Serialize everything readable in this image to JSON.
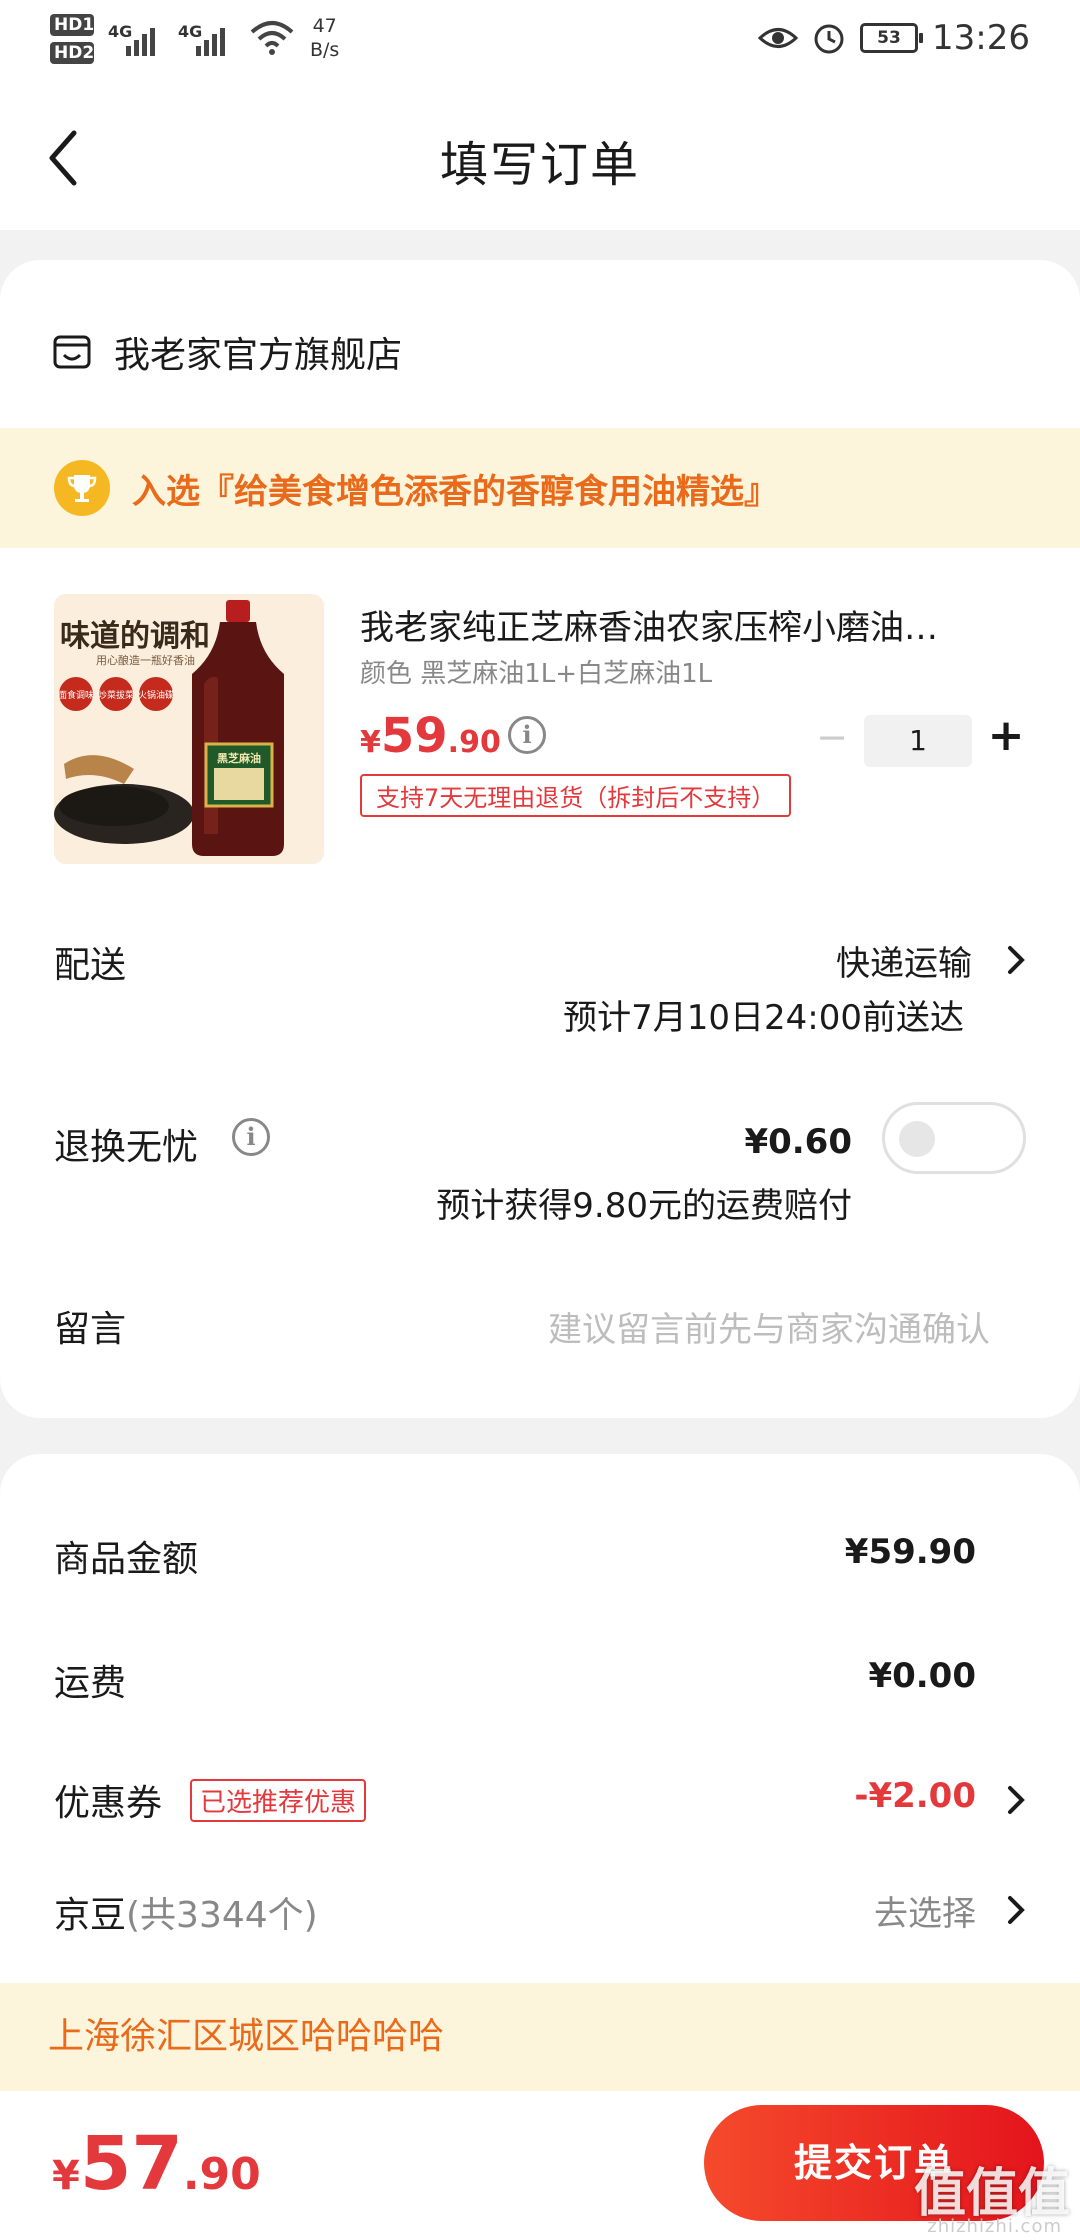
{
  "status_bar": {
    "sim1": "HD",
    "sim2": "HD",
    "sim1_sub": "1",
    "sim2_sub": "2",
    "net1": "4G",
    "net2": "4G",
    "speed_value": "47",
    "speed_unit": "B/s",
    "battery": "53",
    "time": "13:26",
    "icons": [
      "eye-icon",
      "alarm-icon",
      "wifi-icon",
      "signal-icon",
      "battery-icon"
    ]
  },
  "header": {
    "title": "填写订单"
  },
  "store": {
    "name": "我老家官方旗舰店"
  },
  "banner": {
    "text": "入选『给美食增色添香的香醇食用油精选』"
  },
  "product": {
    "title": "我老家纯正芝麻香油农家压榨小磨油…",
    "spec": "颜色 黑芝麻油1L+白芝麻油1L",
    "price_symbol": "¥",
    "price_int": "59",
    "price_dec": ".90",
    "quantity": "1",
    "minus": "−",
    "plus": "+",
    "return_tag": "支持7天无理由退货（拆封后不支持）",
    "image_text": {
      "headline": "味道的调和",
      "sub": "用心酿造一瓶好香油",
      "badge1": "面食调味",
      "badge2": "炒菜拔菜",
      "badge3": "火锅油碟",
      "label": "黑芝麻油"
    }
  },
  "delivery": {
    "label": "配送",
    "method": "快递运输",
    "eta": "预计7月10日24:00前送达"
  },
  "insurance": {
    "label": "退换无忧",
    "price": "¥0.60",
    "sub": "预计获得9.80元的运费赔付",
    "enabled": false
  },
  "remark": {
    "label": "留言",
    "placeholder": "建议留言前先与商家沟通确认"
  },
  "summary": {
    "goods_label": "商品金额",
    "goods_value": "¥59.90",
    "shipping_label": "运费",
    "shipping_value": "¥0.00",
    "coupon_label": "优惠券",
    "coupon_tag": "已选推荐优惠",
    "coupon_value": "-¥2.00",
    "jd_label": "京豆",
    "jd_count": "(共3344个)",
    "jd_action": "去选择"
  },
  "address": {
    "text": "上海徐汇区城区哈哈哈哈"
  },
  "bottom": {
    "total_symbol": "¥",
    "total_int": "57",
    "total_dec": ".90",
    "submit_label": "提交订单",
    "watermark": "值值值",
    "watermark_site": "zhizhizhi.com"
  },
  "colors": {
    "accent_red": "#e4393c",
    "banner_orange": "#e86a1a",
    "banner_bg": "#fdf4dc",
    "page_bg": "#f2f2f2"
  }
}
